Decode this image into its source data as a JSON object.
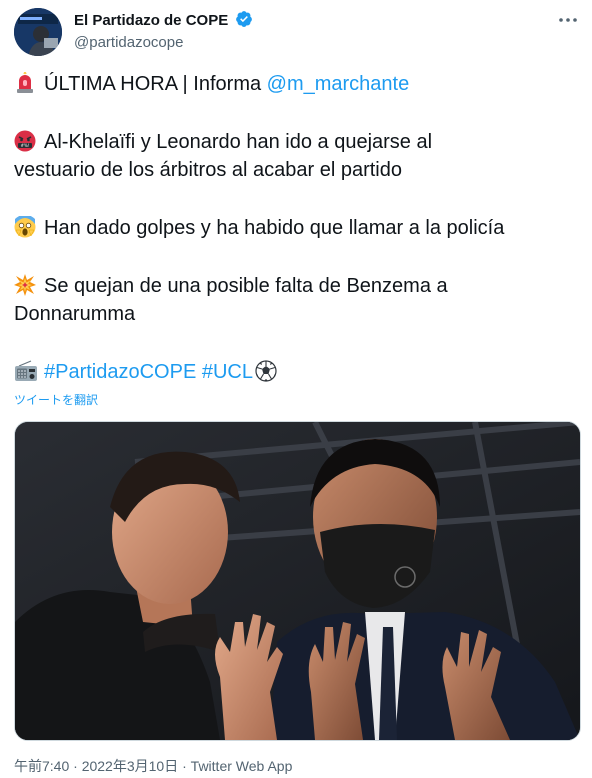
{
  "account": {
    "display_name": "El Partidazo de COPE",
    "handle": "@partidazocope",
    "verified": true,
    "avatar_icon": "avatar-icon"
  },
  "tweet": {
    "line1_prefix": "ÚLTIMA HORA | Informa ",
    "line1_mention": "@m_marchante",
    "para2_line1": "Al-Khelaïfi y Leonardo han ido a quejarse al",
    "para2_line2": "vestuario de los árbitros al acabar el partido",
    "para3": "Han dado golpes y ha habido que llamar a la policía",
    "para4_line1": "Se quejan de una posible falta de Benzema a",
    "para4_line2": "Donnarumma",
    "hashtag1": "#PartidazoCOPE",
    "hashtag2": "#UCL",
    "emojis": [
      "rotating-light-icon",
      "cursing-face-icon",
      "screaming-face-icon",
      "collision-icon",
      "radio-icon",
      "soccer-ball-icon"
    ],
    "translate_label": "ツイートを翻訳"
  },
  "meta": {
    "time": "午前7:40",
    "date": "2022年3月10日",
    "source": "Twitter Web App",
    "separator": " · "
  },
  "colors": {
    "link": "#1d9bf0",
    "text": "#0f1419",
    "secondary": "#536471",
    "verified": "#1d9bf0"
  }
}
